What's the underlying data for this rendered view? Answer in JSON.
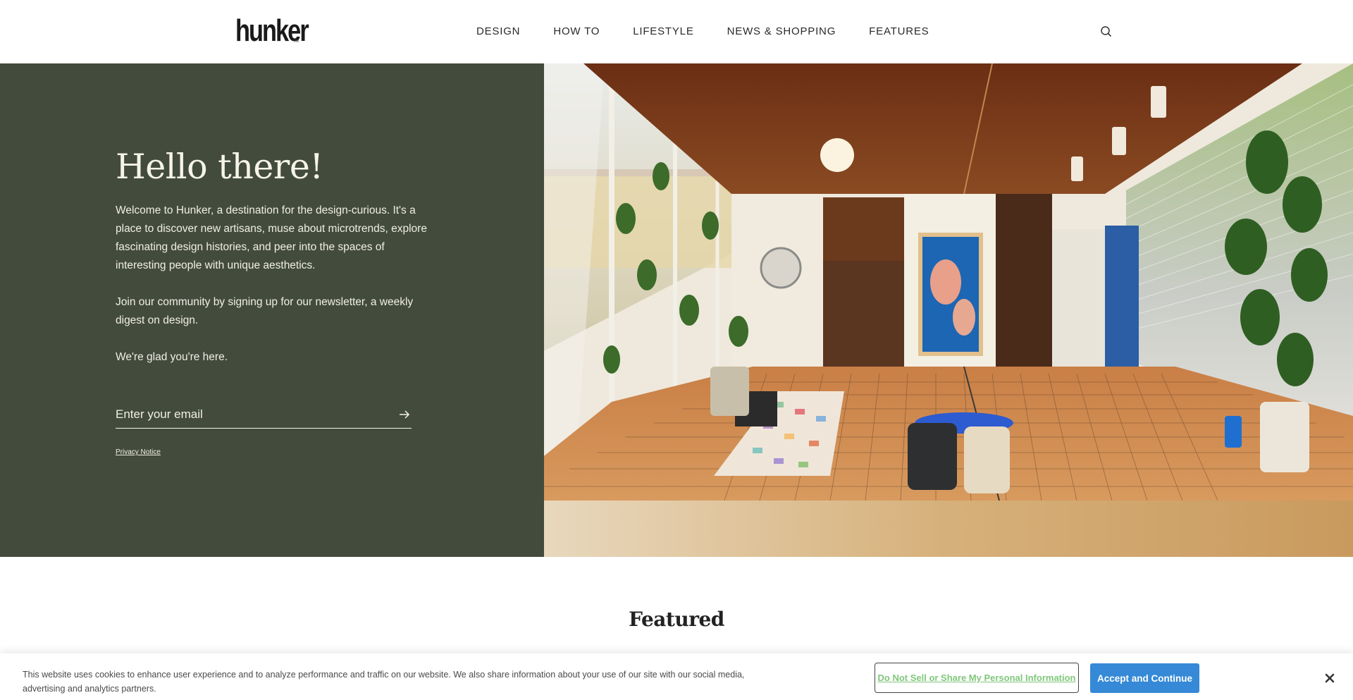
{
  "header": {
    "logo_text": "hunker",
    "logo_tm": "TM",
    "nav": [
      {
        "label": "DESIGN"
      },
      {
        "label": "HOW TO"
      },
      {
        "label": "LIFESTYLE"
      },
      {
        "label": "NEWS & SHOPPING"
      },
      {
        "label": "FEATURES"
      }
    ],
    "search_icon": "search-icon"
  },
  "hero": {
    "title": "Hello there!",
    "paragraph_1": "Welcome to Hunker, a destination for the design-curious. It's a place to discover new artisans, muse about microtrends, explore fascinating design histories, and peer into the spaces of interesting people with unique aesthetics.",
    "paragraph_2": "Join our community by signing up for our newsletter, a weekly digest on design.",
    "paragraph_3": "We're glad you're here.",
    "email_placeholder": "Enter your email",
    "submit_icon": "arrow-right-icon",
    "privacy_link": "Privacy Notice",
    "background_color": "#434c3c",
    "image_alt": "Mid-century modern interior with wood ceiling, tile floor, plants and blue dining table"
  },
  "featured": {
    "title": "Featured"
  },
  "cookie_banner": {
    "text": "This website uses cookies to enhance user experience and to analyze performance and traffic on our website. We also share information about your use of our site with our social media, advertising and analytics partners.",
    "dns_label": "Do Not Sell or Share My Personal Information",
    "accept_label": "Accept and Continue",
    "close_icon": "close-icon",
    "accent_color": "#3589d6",
    "link_color": "#7fc77a"
  }
}
